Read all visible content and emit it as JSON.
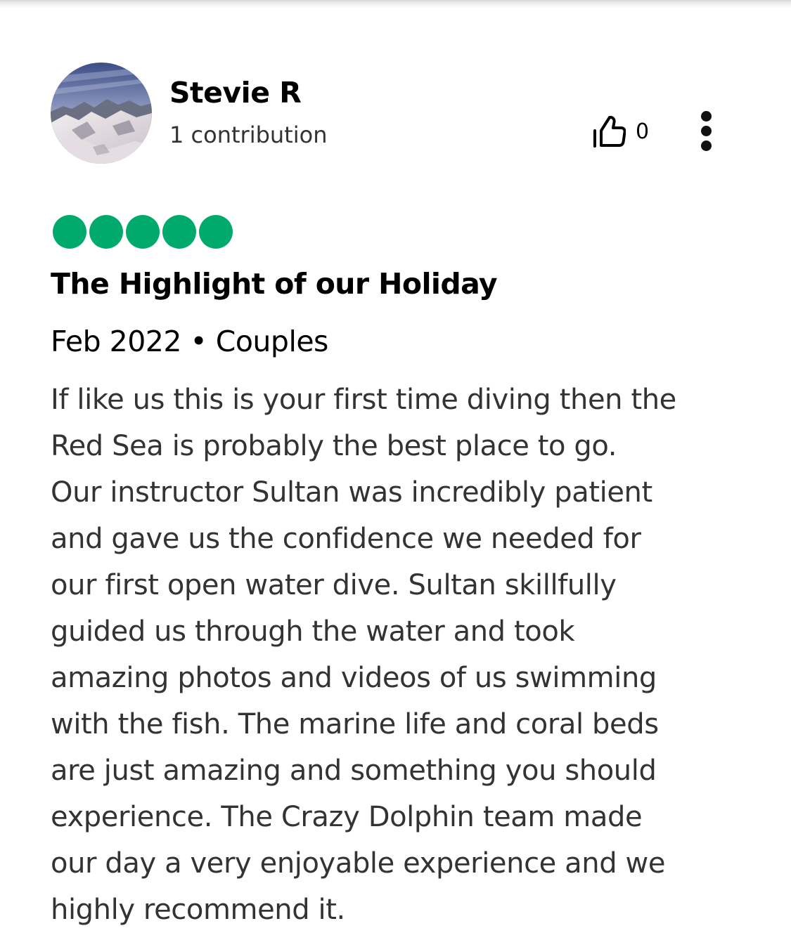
{
  "reviewer": {
    "name": "Stevie R",
    "contributions": "1 contribution"
  },
  "helpful": {
    "icon": "thumbs-up-icon",
    "count": "0"
  },
  "more_menu": {
    "icon": "more-vertical-icon"
  },
  "rating": {
    "value": 5,
    "max": 5,
    "color": "#00aa6c"
  },
  "review": {
    "title": "The Highlight of our Holiday",
    "meta": "Feb 2022 • Couples",
    "body_lines": [
      "If like us this is your first time diving then the",
      "Red Sea is probably the best place to go.",
      "Our instructor Sultan was incredibly patient",
      "and gave us the confidence we needed for",
      "our first open water dive. Sultan skillfully",
      "guided us through the water and took",
      "amazing photos and videos of us swimming",
      "with the fish. The marine life and coral beds",
      "are just amazing and something you should",
      "experience. The Crazy Dolphin team made",
      "our day a very enjoyable experience and we",
      "highly recommend it."
    ]
  }
}
